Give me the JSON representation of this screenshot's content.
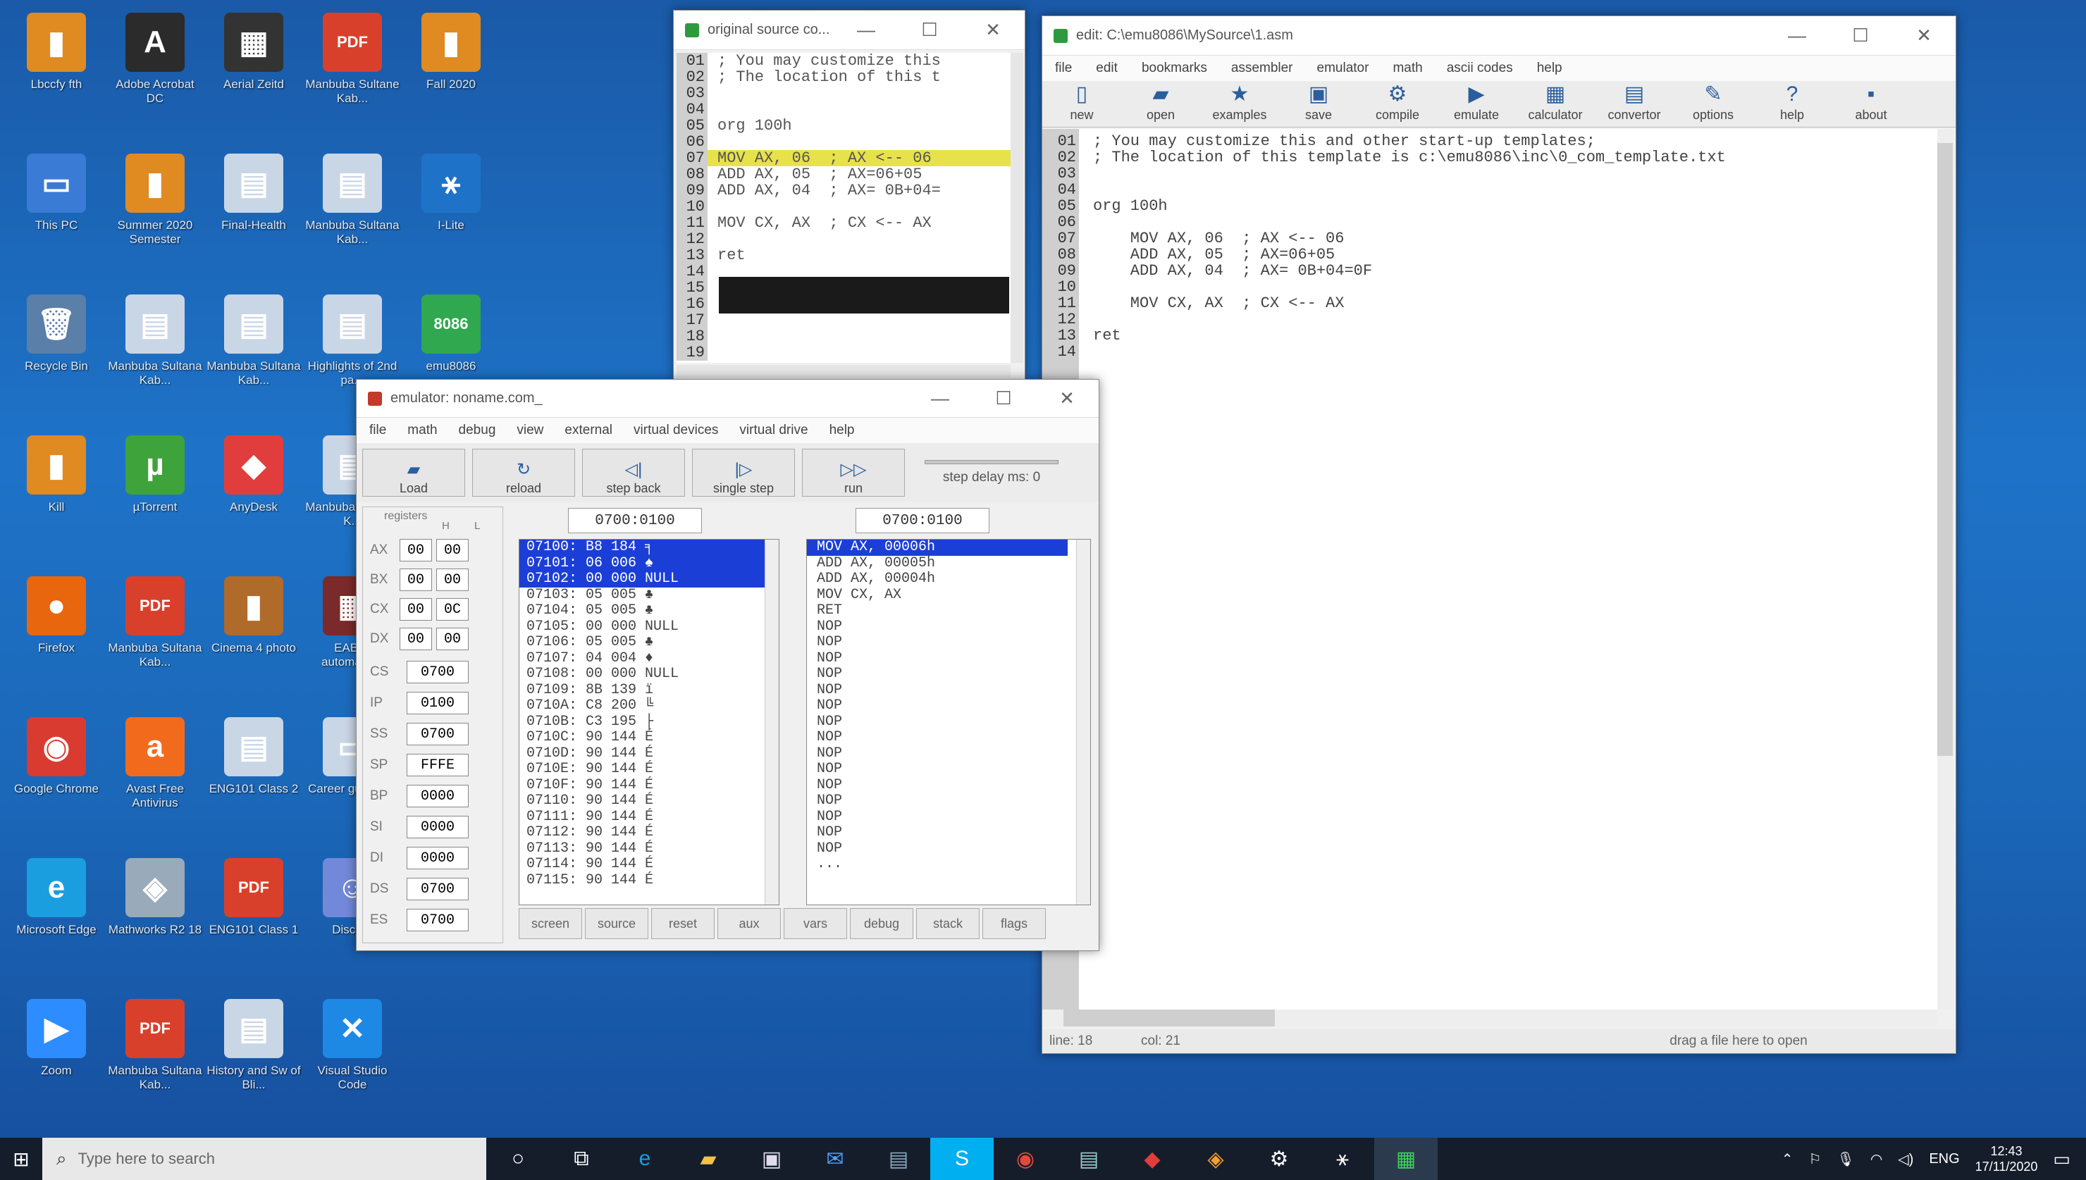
{
  "desktop": {
    "icons": [
      {
        "label": "Lbccfy fth",
        "glyph": "▮",
        "color": "#e08a22",
        "col": 0,
        "row": 0
      },
      {
        "label": "Adobe Acrobat DC",
        "glyph": "A",
        "color": "#2b2b2b",
        "col": 1,
        "row": 0
      },
      {
        "label": "Aerial Zeitd",
        "glyph": "▦",
        "color": "#333",
        "col": 2,
        "row": 0
      },
      {
        "label": "Manbuba Sultane Kab...",
        "glyph": "PDF",
        "color": "#d9402b",
        "col": 3,
        "row": 0
      },
      {
        "label": "Fall 2020",
        "glyph": "▮",
        "color": "#e08a22",
        "col": 4,
        "row": 0
      },
      {
        "label": "This PC",
        "glyph": "▭",
        "color": "#3a7bd5",
        "col": 0,
        "row": 1
      },
      {
        "label": "Summer 2020 Semester",
        "glyph": "▮",
        "color": "#e08a22",
        "col": 1,
        "row": 1
      },
      {
        "label": "Final-Health",
        "glyph": "▤",
        "color": "#c9d6e6",
        "col": 2,
        "row": 1
      },
      {
        "label": "Manbuba Sultana Kab...",
        "glyph": "▤",
        "color": "#c9d6e6",
        "col": 3,
        "row": 1
      },
      {
        "label": "I-Lite",
        "glyph": "⚹",
        "color": "#1e73c8",
        "col": 4,
        "row": 1
      },
      {
        "label": "Recycle Bin",
        "glyph": "🗑",
        "color": "#5a7fa8",
        "col": 0,
        "row": 2
      },
      {
        "label": "Manbuba Sultana Kab...",
        "glyph": "▤",
        "color": "#c9d6e6",
        "col": 1,
        "row": 2
      },
      {
        "label": "Manbuba Sultana Kab...",
        "glyph": "▤",
        "color": "#c9d6e6",
        "col": 2,
        "row": 2
      },
      {
        "label": "Highlights of 2nd pa...",
        "glyph": "▤",
        "color": "#c9d6e6",
        "col": 3,
        "row": 2
      },
      {
        "label": "emu8086",
        "glyph": "8086",
        "color": "#2fa84f",
        "col": 4,
        "row": 2
      },
      {
        "label": "Kill",
        "glyph": "▮",
        "color": "#e08a22",
        "col": 0,
        "row": 3
      },
      {
        "label": "µTorrent",
        "glyph": "µ",
        "color": "#3ea33a",
        "col": 1,
        "row": 3
      },
      {
        "label": "AnyDesk",
        "glyph": "◆",
        "color": "#e23d3d",
        "col": 2,
        "row": 3
      },
      {
        "label": "Manbuba Sultana K...",
        "glyph": "▤",
        "color": "#c9d6e6",
        "col": 3,
        "row": 3
      },
      {
        "label": "Firefox",
        "glyph": "●",
        "color": "#e8660d",
        "col": 0,
        "row": 4
      },
      {
        "label": "Manbuba Sultana Kab...",
        "glyph": "PDF",
        "color": "#d9402b",
        "col": 1,
        "row": 4
      },
      {
        "label": "Cinema 4 photo",
        "glyph": "▮",
        "color": "#b06a2a",
        "col": 2,
        "row": 4
      },
      {
        "label": "EAB11 automatic...",
        "glyph": "▦",
        "color": "#7a2a2a",
        "col": 3,
        "row": 4
      },
      {
        "label": "Google Chrome",
        "glyph": "◉",
        "color": "#d93b30",
        "col": 0,
        "row": 5
      },
      {
        "label": "Avast Free Antivirus",
        "glyph": "a",
        "color": "#f26b1d",
        "col": 1,
        "row": 5
      },
      {
        "label": "ENG101 Class 2",
        "glyph": "▤",
        "color": "#c9d6e6",
        "col": 2,
        "row": 5
      },
      {
        "label": "Career guidance",
        "glyph": "▭",
        "color": "#c9d6e6",
        "col": 3,
        "row": 5
      },
      {
        "label": "Microsoft Edge",
        "glyph": "e",
        "color": "#1a9ee0",
        "col": 0,
        "row": 6
      },
      {
        "label": "Mathworks R2 18",
        "glyph": "◈",
        "color": "#9ab",
        "col": 1,
        "row": 6
      },
      {
        "label": "ENG101 Class 1",
        "glyph": "PDF",
        "color": "#d9402b",
        "col": 2,
        "row": 6
      },
      {
        "label": "Discord",
        "glyph": "☺",
        "color": "#7289da",
        "col": 3,
        "row": 6
      },
      {
        "label": "Zoom",
        "glyph": "▶",
        "color": "#2d8cff",
        "col": 0,
        "row": 7
      },
      {
        "label": "Manbuba Sultana Kab...",
        "glyph": "PDF",
        "color": "#d9402b",
        "col": 1,
        "row": 7
      },
      {
        "label": "History and Sw of Bli...",
        "glyph": "▤",
        "color": "#c9d6e6",
        "col": 2,
        "row": 7
      },
      {
        "label": "Visual Studio Code",
        "glyph": "✕",
        "color": "#1e88e5",
        "col": 3,
        "row": 7
      }
    ]
  },
  "source_window": {
    "title": "original source co...",
    "lines": [
      {
        "num": "01",
        "text": "; You may customize this"
      },
      {
        "num": "02",
        "text": "; The location of this t"
      },
      {
        "num": "03",
        "text": ""
      },
      {
        "num": "04",
        "text": ""
      },
      {
        "num": "05",
        "text": "org 100h"
      },
      {
        "num": "06",
        "text": ""
      },
      {
        "num": "07",
        "text": "MOV AX, 06  ; AX <-- 06",
        "hl": true
      },
      {
        "num": "08",
        "text": "ADD AX, 05  ; AX=06+05"
      },
      {
        "num": "09",
        "text": "ADD AX, 04  ; AX= 0B+04="
      },
      {
        "num": "10",
        "text": ""
      },
      {
        "num": "11",
        "text": "MOV CX, AX  ; CX <-- AX"
      },
      {
        "num": "12",
        "text": ""
      },
      {
        "num": "13",
        "text": "ret"
      },
      {
        "num": "14",
        "text": ""
      },
      {
        "num": "15",
        "text": ""
      },
      {
        "num": "16",
        "text": ""
      },
      {
        "num": "17",
        "text": ""
      },
      {
        "num": "18",
        "text": ""
      },
      {
        "num": "19",
        "text": ""
      }
    ]
  },
  "editor_window": {
    "title": "edit: C:\\emu8086\\MySource\\1.asm",
    "menu": [
      "file",
      "edit",
      "bookmarks",
      "assembler",
      "emulator",
      "math",
      "ascii codes",
      "help"
    ],
    "toolbar": [
      {
        "label": "new",
        "icon": "new-file-icon",
        "glyph": "▯"
      },
      {
        "label": "open",
        "icon": "open-icon",
        "glyph": "▰"
      },
      {
        "label": "examples",
        "icon": "examples-icon",
        "glyph": "★"
      },
      {
        "label": "save",
        "icon": "save-icon",
        "glyph": "▣"
      },
      {
        "label": "compile",
        "icon": "compile-icon",
        "glyph": "⚙"
      },
      {
        "label": "emulate",
        "icon": "emulate-icon",
        "glyph": "▶"
      },
      {
        "label": "calculator",
        "icon": "calculator-icon",
        "glyph": "▦"
      },
      {
        "label": "convertor",
        "icon": "convertor-icon",
        "glyph": "▤"
      },
      {
        "label": "options",
        "icon": "options-icon",
        "glyph": "✎"
      },
      {
        "label": "help",
        "icon": "help-icon",
        "glyph": "?"
      },
      {
        "label": "about",
        "icon": "about-icon",
        "glyph": "▪"
      }
    ],
    "line_numbers": [
      "01",
      "02",
      "03",
      "04",
      "05",
      "06",
      "07",
      "08",
      "09",
      "10",
      "11",
      "12",
      "13",
      "14"
    ],
    "lines": [
      "; You may customize this and other start-up templates;",
      "; The location of this template is c:\\emu8086\\inc\\0_com_template.txt",
      "",
      "",
      "org 100h",
      "",
      "    MOV AX, 06  ; AX <-- 06",
      "    ADD AX, 05  ; AX=06+05",
      "    ADD AX, 04  ; AX= 0B+04=0F",
      "",
      "    MOV CX, AX  ; CX <-- AX",
      "",
      "ret",
      ""
    ],
    "status": {
      "line": "line: 18",
      "col": "col: 21",
      "hint": "drag a file here to open"
    }
  },
  "emulator_window": {
    "title": "emulator: noname.com_",
    "menu": [
      "file",
      "math",
      "debug",
      "view",
      "external",
      "virtual devices",
      "virtual drive",
      "help"
    ],
    "toolbar": [
      {
        "label": "Load",
        "icon": "load-icon",
        "glyph": "▰"
      },
      {
        "label": "reload",
        "icon": "reload-icon",
        "glyph": "↻"
      },
      {
        "label": "step back",
        "icon": "step-back-icon",
        "glyph": "◁|"
      },
      {
        "label": "single step",
        "icon": "single-step-icon",
        "glyph": "|▷"
      },
      {
        "label": "run",
        "icon": "run-icon",
        "glyph": "▷▷"
      }
    ],
    "step_delay": "step delay ms: 0",
    "registers_label": "registers",
    "h_label": "H",
    "l_label": "L",
    "regs_hl": [
      {
        "name": "AX",
        "h": "00",
        "l": "00"
      },
      {
        "name": "BX",
        "h": "00",
        "l": "00"
      },
      {
        "name": "CX",
        "h": "00",
        "l": "0C"
      },
      {
        "name": "DX",
        "h": "00",
        "l": "00"
      }
    ],
    "regs": [
      {
        "name": "CS",
        "value": "0700"
      },
      {
        "name": "IP",
        "value": "0100"
      },
      {
        "name": "SS",
        "value": "0700"
      },
      {
        "name": "SP",
        "value": "FFFE"
      },
      {
        "name": "BP",
        "value": "0000"
      },
      {
        "name": "SI",
        "value": "0000"
      },
      {
        "name": "DI",
        "value": "0000"
      },
      {
        "name": "DS",
        "value": "0700"
      },
      {
        "name": "ES",
        "value": "0700"
      }
    ],
    "addr_left": "0700:0100",
    "addr_right": "0700:0100",
    "memory": [
      {
        "text": "07100: B8 184 ╕",
        "sel": true
      },
      {
        "text": "07101: 06 006 ♠",
        "sel": true
      },
      {
        "text": "07102: 00 000 NULL",
        "sel": true
      },
      {
        "text": "07103: 05 005 ♣"
      },
      {
        "text": "07104: 05 005 ♣"
      },
      {
        "text": "07105: 00 000 NULL"
      },
      {
        "text": "07106: 05 005 ♣"
      },
      {
        "text": "07107: 04 004 ♦"
      },
      {
        "text": "07108: 00 000 NULL"
      },
      {
        "text": "07109: 8B 139 ï"
      },
      {
        "text": "0710A: C8 200 ╚"
      },
      {
        "text": "0710B: C3 195 ├"
      },
      {
        "text": "0710C: 90 144 É"
      },
      {
        "text": "0710D: 90 144 É"
      },
      {
        "text": "0710E: 90 144 É"
      },
      {
        "text": "0710F: 90 144 É"
      },
      {
        "text": "07110: 90 144 É"
      },
      {
        "text": "07111: 90 144 É"
      },
      {
        "text": "07112: 90 144 É"
      },
      {
        "text": "07113: 90 144 É"
      },
      {
        "text": "07114: 90 144 É"
      },
      {
        "text": "07115: 90 144 É"
      }
    ],
    "disasm": [
      {
        "text": "MOV AX, 00006h",
        "sel": true
      },
      {
        "text": "ADD AX, 00005h"
      },
      {
        "text": "ADD AX, 00004h"
      },
      {
        "text": "MOV CX, AX"
      },
      {
        "text": "RET"
      },
      {
        "text": "NOP"
      },
      {
        "text": "NOP"
      },
      {
        "text": "NOP"
      },
      {
        "text": "NOP"
      },
      {
        "text": "NOP"
      },
      {
        "text": "NOP"
      },
      {
        "text": "NOP"
      },
      {
        "text": "NOP"
      },
      {
        "text": "NOP"
      },
      {
        "text": "NOP"
      },
      {
        "text": "NOP"
      },
      {
        "text": "NOP"
      },
      {
        "text": "NOP"
      },
      {
        "text": "NOP"
      },
      {
        "text": "NOP"
      },
      {
        "text": "..."
      }
    ],
    "bottom_buttons": [
      "screen",
      "source",
      "reset",
      "aux",
      "vars",
      "debug",
      "stack",
      "flags"
    ]
  },
  "taskbar": {
    "search_placeholder": "Type here to search",
    "apps": [
      {
        "icon": "cortana-icon",
        "glyph": "○",
        "color": "#fff"
      },
      {
        "icon": "task-view-icon",
        "glyph": "⧉",
        "color": "#fff"
      },
      {
        "icon": "edge-icon",
        "glyph": "e",
        "color": "#1a9ee0"
      },
      {
        "icon": "file-explorer-icon",
        "glyph": "▰",
        "color": "#f2c14e"
      },
      {
        "icon": "store-icon",
        "glyph": "▣",
        "color": "#dde"
      },
      {
        "icon": "mail-icon",
        "glyph": "✉",
        "color": "#4aa3ff"
      },
      {
        "icon": "app-icon",
        "glyph": "▤",
        "color": "#8ab"
      },
      {
        "icon": "skype-icon",
        "glyph": "S",
        "color": "#fff"
      },
      {
        "icon": "chrome-icon",
        "glyph": "◉",
        "color": "#e04a3c"
      },
      {
        "icon": "document-icon",
        "glyph": "▤",
        "color": "#9cc"
      },
      {
        "icon": "anydesk-icon",
        "glyph": "◆",
        "color": "#e23d3d"
      },
      {
        "icon": "git-icon",
        "glyph": "◈",
        "color": "#f0a030"
      },
      {
        "icon": "settings-icon",
        "glyph": "⚙",
        "color": "#fff"
      },
      {
        "icon": "ilite-icon",
        "glyph": "⚹",
        "color": "#fff"
      },
      {
        "icon": "emu8086-icon",
        "glyph": "▦",
        "color": "#3bd15c"
      }
    ],
    "tray": {
      "lang": "ENG",
      "time": "12:43",
      "date": "17/11/2020"
    }
  },
  "colors": {
    "highlight_yellow": "#e8e24a",
    "selection_blue": "#1b3fd6",
    "taskbar": "#151d2b"
  }
}
